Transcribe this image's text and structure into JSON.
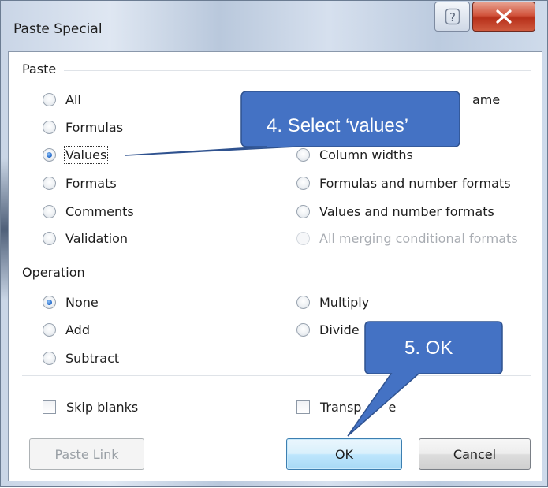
{
  "window": {
    "title": "Paste Special",
    "help_glyph": "?",
    "close_glyph": "X"
  },
  "paste": {
    "section_label": "Paste",
    "left_options": [
      {
        "label": "All",
        "checked": false,
        "disabled": false
      },
      {
        "label": "Formulas",
        "checked": false,
        "disabled": false
      },
      {
        "label": "Values",
        "checked": true,
        "disabled": false
      },
      {
        "label": "Formats",
        "checked": false,
        "disabled": false
      },
      {
        "label": "Comments",
        "checked": false,
        "disabled": false
      },
      {
        "label": "Validation",
        "checked": false,
        "disabled": false
      }
    ],
    "right_options": [
      {
        "label": "ame",
        "checked": false,
        "disabled": false
      },
      {
        "label": "",
        "checked": false,
        "disabled": false
      },
      {
        "label": "Column widths",
        "checked": false,
        "disabled": false
      },
      {
        "label": "Formulas and number formats",
        "checked": false,
        "disabled": false
      },
      {
        "label": "Values and number formats",
        "checked": false,
        "disabled": false
      },
      {
        "label": "All merging conditional formats",
        "checked": false,
        "disabled": true
      }
    ]
  },
  "operation": {
    "section_label": "Operation",
    "left_options": [
      {
        "label": "None",
        "checked": true
      },
      {
        "label": "Add",
        "checked": false
      },
      {
        "label": "Subtract",
        "checked": false
      }
    ],
    "right_options": [
      {
        "label": "Multiply",
        "checked": false
      },
      {
        "label": "Divide",
        "checked": false
      }
    ]
  },
  "checkboxes": {
    "skip_blanks": {
      "label": "Skip blanks",
      "checked": false
    },
    "transpose": {
      "label": "Transp",
      "tail": "e",
      "checked": false
    }
  },
  "buttons": {
    "paste_link": "Paste Link",
    "ok": "OK",
    "cancel": "Cancel"
  },
  "callouts": {
    "step4": "4. Select ‘values’",
    "step5": "5. OK"
  },
  "colors": {
    "callout_fill": "#4472c4",
    "callout_border": "#2f528f",
    "close_button": "#c4442c",
    "radio_selected": "#1f67c9"
  }
}
